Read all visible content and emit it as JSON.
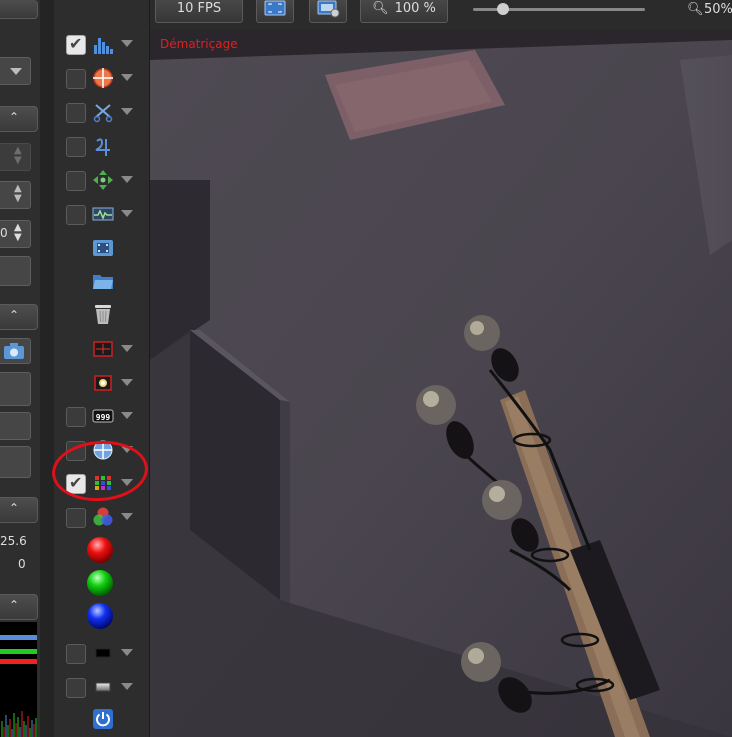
{
  "top_bar": {
    "fps_label": "10 FPS",
    "zoom_left": "100 %",
    "zoom_right": "50%",
    "slider_value": 0.15
  },
  "overlay": {
    "label": "Dématriçage"
  },
  "left_panel": {
    "value_1": "25.6",
    "value_2": "0",
    "value_3": "0",
    "histogram_colors": [
      "#5b8ad8",
      "#22cc22",
      "#ee2222"
    ]
  },
  "tools": [
    {
      "id": "histogram",
      "icon": "histogram-icon",
      "checkbox": true,
      "checked": true,
      "menu": true
    },
    {
      "id": "crosshair",
      "icon": "crosshair-icon",
      "checkbox": true,
      "checked": false,
      "menu": true
    },
    {
      "id": "scissors",
      "icon": "scissors-icon",
      "checkbox": true,
      "checked": false,
      "menu": true
    },
    {
      "id": "symbol",
      "icon": "jupiter-symbol-icon",
      "checkbox": true,
      "checked": false,
      "menu": false
    },
    {
      "id": "move",
      "icon": "move-arrows-icon",
      "checkbox": true,
      "checked": false,
      "menu": true
    },
    {
      "id": "waveform",
      "icon": "waveform-icon",
      "checkbox": true,
      "checked": false,
      "menu": true
    },
    {
      "id": "film",
      "icon": "film-folder-icon",
      "checkbox": false,
      "checked": false,
      "menu": false
    },
    {
      "id": "folder",
      "icon": "folder-icon",
      "checkbox": false,
      "checked": false,
      "menu": false
    },
    {
      "id": "trash",
      "icon": "trash-icon",
      "checkbox": false,
      "checked": false,
      "menu": false
    },
    {
      "id": "target-frame",
      "icon": "target-frame-icon",
      "checkbox": false,
      "checked": false,
      "menu": true
    },
    {
      "id": "star-frame",
      "icon": "star-frame-icon",
      "checkbox": false,
      "checked": false,
      "menu": true
    },
    {
      "id": "counter",
      "icon": "counter-999-icon",
      "checkbox": true,
      "checked": false,
      "menu": true
    },
    {
      "id": "globe",
      "icon": "globe-icon",
      "checkbox": true,
      "checked": false,
      "menu": true
    },
    {
      "id": "bayer",
      "icon": "bayer-grid-icon",
      "checkbox": true,
      "checked": true,
      "menu": true
    },
    {
      "id": "rgb",
      "icon": "rgb-circles-icon",
      "checkbox": true,
      "checked": false,
      "menu": true
    },
    {
      "id": "red",
      "icon": "red-ball-icon",
      "checkbox": false,
      "checked": false,
      "menu": false
    },
    {
      "id": "green",
      "icon": "green-ball-icon",
      "checkbox": false,
      "checked": false,
      "menu": false
    },
    {
      "id": "blue",
      "icon": "blue-ball-icon",
      "checkbox": false,
      "checked": false,
      "menu": false
    },
    {
      "id": "black-rect",
      "icon": "black-rect-icon",
      "checkbox": true,
      "checked": false,
      "menu": true
    },
    {
      "id": "gradient-rect",
      "icon": "gradient-rect-icon",
      "checkbox": true,
      "checked": false,
      "menu": true
    },
    {
      "id": "power",
      "icon": "power-icon",
      "checkbox": false,
      "checked": false,
      "menu": false
    }
  ]
}
